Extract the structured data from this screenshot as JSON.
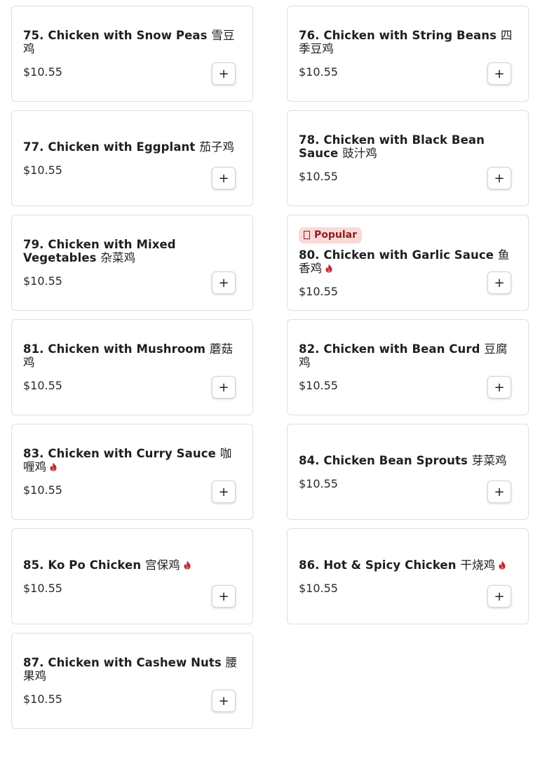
{
  "items": [
    {
      "title": "75. Chicken with Snow Peas",
      "cn": "雪豆鸡",
      "price": "$10.55",
      "spicy": false,
      "popular": false
    },
    {
      "title": "76. Chicken with String Beans",
      "cn": "四季豆鸡",
      "price": "$10.55",
      "spicy": false,
      "popular": false
    },
    {
      "title": "77. Chicken with Eggplant",
      "cn": "茄子鸡",
      "price": "$10.55",
      "spicy": false,
      "popular": false
    },
    {
      "title": "78. Chicken with Black Bean Sauce",
      "cn": "豉汁鸡",
      "price": "$10.55",
      "spicy": false,
      "popular": false
    },
    {
      "title": "79. Chicken with Mixed Vegetables",
      "cn": "杂菜鸡",
      "price": "$10.55",
      "spicy": false,
      "popular": false
    },
    {
      "title": "80. Chicken with Garlic Sauce",
      "cn": "鱼香鸡",
      "price": "$10.55",
      "spicy": true,
      "popular": true
    },
    {
      "title": "81. Chicken with Mushroom",
      "cn": "蘑菇鸡",
      "price": "$10.55",
      "spicy": false,
      "popular": false
    },
    {
      "title": "82. Chicken with Bean Curd",
      "cn": "豆腐鸡",
      "price": "$10.55",
      "spicy": false,
      "popular": false
    },
    {
      "title": "83. Chicken with Curry Sauce",
      "cn": "咖喱鸡",
      "price": "$10.55",
      "spicy": true,
      "popular": false
    },
    {
      "title": "84. Chicken Bean Sprouts",
      "cn": "芽菜鸡",
      "price": "$10.55",
      "spicy": false,
      "popular": false
    },
    {
      "title": "85. Ko Po Chicken",
      "cn": "宫保鸡",
      "price": "$10.55",
      "spicy": true,
      "popular": false
    },
    {
      "title": "86. Hot & Spicy Chicken",
      "cn": "干烧鸡",
      "price": "$10.55",
      "spicy": true,
      "popular": false
    },
    {
      "title": "87. Chicken with Cashew Nuts",
      "cn": "腰果鸡",
      "price": "$10.55",
      "spicy": false,
      "popular": false
    }
  ],
  "badge_label": "Popular",
  "add_label": "+",
  "icons": {
    "spicy": "flame-icon",
    "popular": "popular-icon",
    "add": "plus-icon"
  },
  "colors": {
    "flame": "#c0282d",
    "badge_bg": "#fbd9d9",
    "badge_text": "#8a1f1f"
  }
}
